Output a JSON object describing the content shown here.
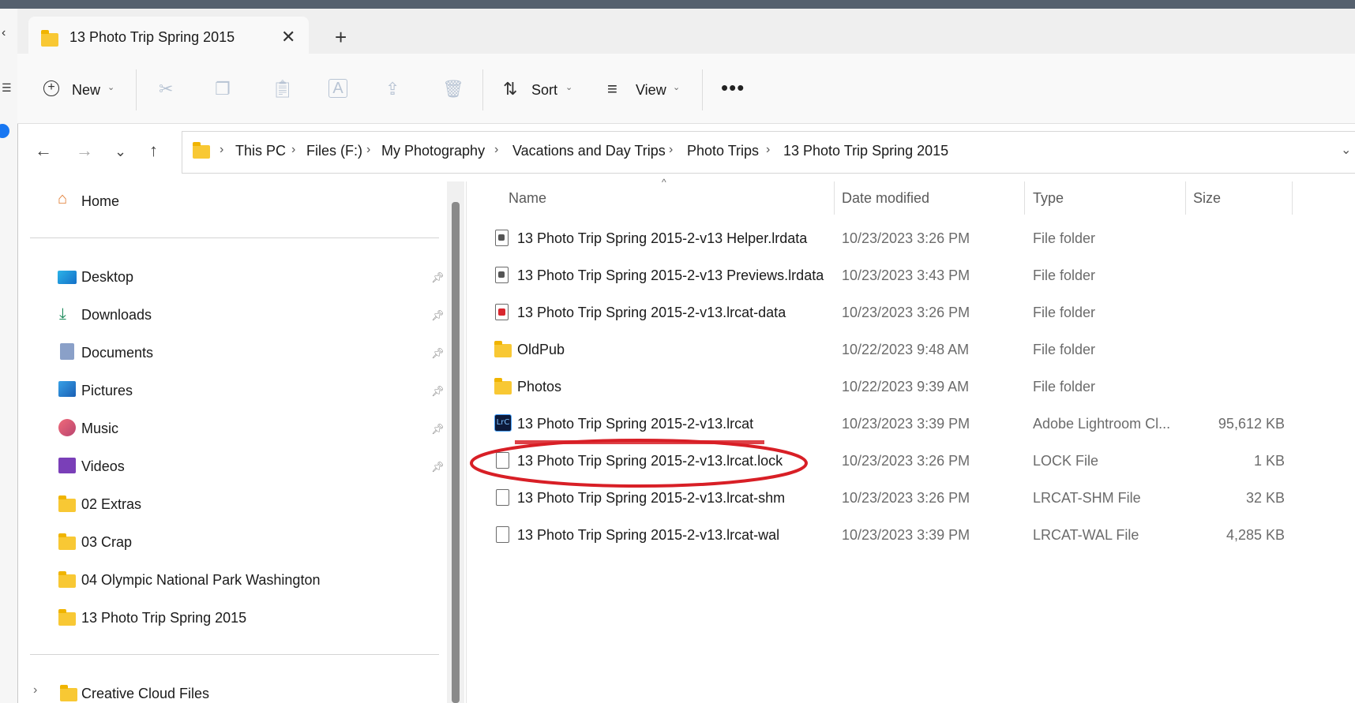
{
  "tab": {
    "title": "13 Photo Trip Spring 2015"
  },
  "toolbar": {
    "new_label": "New",
    "sort_label": "Sort",
    "view_label": "View"
  },
  "address": {
    "crumbs": [
      "This PC",
      "Files (F:)",
      "My Photography",
      "Vacations and Day Trips",
      "Photo Trips",
      "13 Photo Trip Spring 2015"
    ]
  },
  "sidebar": {
    "home": "Home",
    "quick": [
      "Desktop",
      "Downloads",
      "Documents",
      "Pictures",
      "Music",
      "Videos"
    ],
    "folders": [
      "02 Extras",
      "03 Crap",
      "04 Olympic National Park Washington",
      "13 Photo Trip Spring 2015"
    ],
    "creative_cloud": "Creative Cloud Files"
  },
  "columns": {
    "name": "Name",
    "date": "Date modified",
    "type": "Type",
    "size": "Size"
  },
  "files": [
    {
      "name": "13 Photo Trip Spring 2015-2-v13 Helper.lrdata",
      "date": "10/23/2023 3:26 PM",
      "type": "File folder",
      "size": "",
      "icon": "lrdata-icon"
    },
    {
      "name": "13 Photo Trip Spring 2015-2-v13 Previews.lrdata",
      "date": "10/23/2023 3:43 PM",
      "type": "File folder",
      "size": "",
      "icon": "lrdata-icon"
    },
    {
      "name": "13 Photo Trip Spring 2015-2-v13.lrcat-data",
      "date": "10/23/2023 3:26 PM",
      "type": "File folder",
      "size": "",
      "icon": "lrcat-data-icon"
    },
    {
      "name": "OldPub",
      "date": "10/22/2023 9:48 AM",
      "type": "File folder",
      "size": "",
      "icon": "folder-icon"
    },
    {
      "name": "Photos",
      "date": "10/22/2023 9:39 AM",
      "type": "File folder",
      "size": "",
      "icon": "folder-icon"
    },
    {
      "name": "13 Photo Trip Spring 2015-2-v13.lrcat",
      "date": "10/23/2023 3:39 PM",
      "type": "Adobe Lightroom Cl...",
      "size": "95,612 KB",
      "icon": "lightroom-catalog-icon",
      "icon_text": "LrC"
    },
    {
      "name": "13 Photo Trip Spring 2015-2-v13.lrcat.lock",
      "date": "10/23/2023 3:26 PM",
      "type": "LOCK File",
      "size": "1 KB",
      "icon": "file-icon"
    },
    {
      "name": "13 Photo Trip Spring 2015-2-v13.lrcat-shm",
      "date": "10/23/2023 3:26 PM",
      "type": "LRCAT-SHM File",
      "size": "32 KB",
      "icon": "file-icon"
    },
    {
      "name": "13 Photo Trip Spring 2015-2-v13.lrcat-wal",
      "date": "10/23/2023 3:39 PM",
      "type": "LRCAT-WAL File",
      "size": "4,285 KB",
      "icon": "file-icon"
    }
  ],
  "colors": {
    "annotation": "#d81f26",
    "folder": "#f8c834",
    "accent": "#0067c0"
  }
}
